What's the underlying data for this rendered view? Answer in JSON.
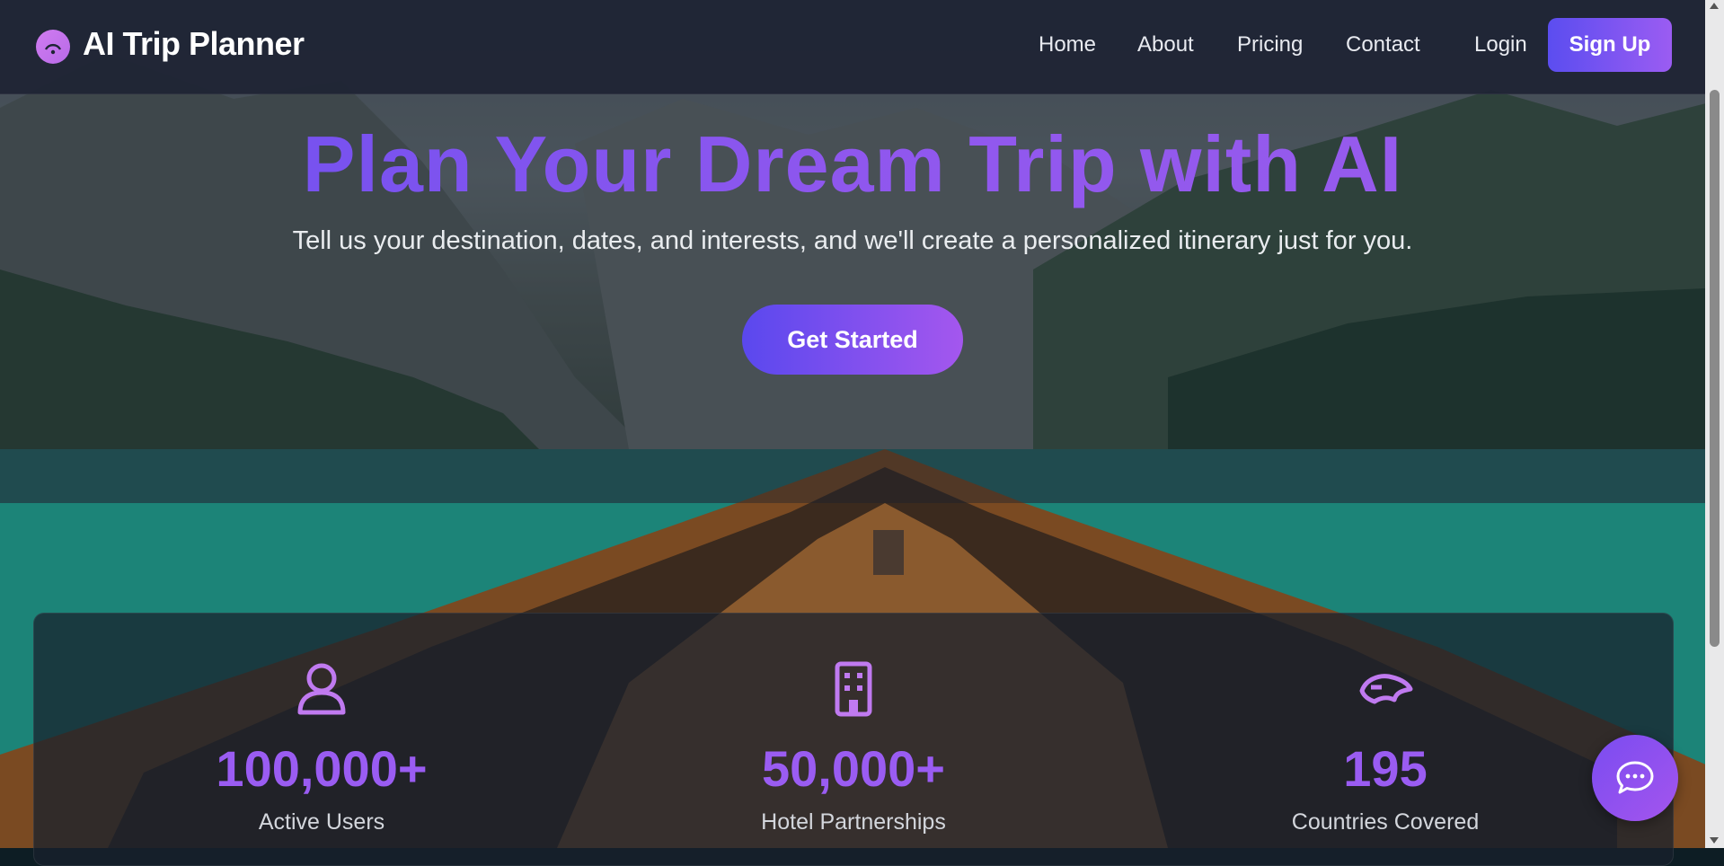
{
  "app": {
    "title": "AI Trip Planner"
  },
  "nav": {
    "links": [
      "Home",
      "About",
      "Pricing",
      "Contact"
    ],
    "login": "Login",
    "signup": "Sign Up"
  },
  "hero": {
    "headline": "Plan Your Dream Trip with AI",
    "subtitle": "Tell us your destination, dates, and interests, and we'll create a personalized itinerary just for you.",
    "cta": "Get Started"
  },
  "stats": [
    {
      "icon": "user-icon",
      "value": "100,000+",
      "label": "Active Users"
    },
    {
      "icon": "building-icon",
      "value": "50,000+",
      "label": "Hotel Partnerships"
    },
    {
      "icon": "globe-icon",
      "value": "195",
      "label": "Countries Covered"
    }
  ],
  "chat": {
    "icon": "chat-bubble-icon"
  },
  "colors": {
    "accent": "#9a5cf2",
    "accent_start": "#5b4df0",
    "nav_bg": "#1e2434"
  }
}
